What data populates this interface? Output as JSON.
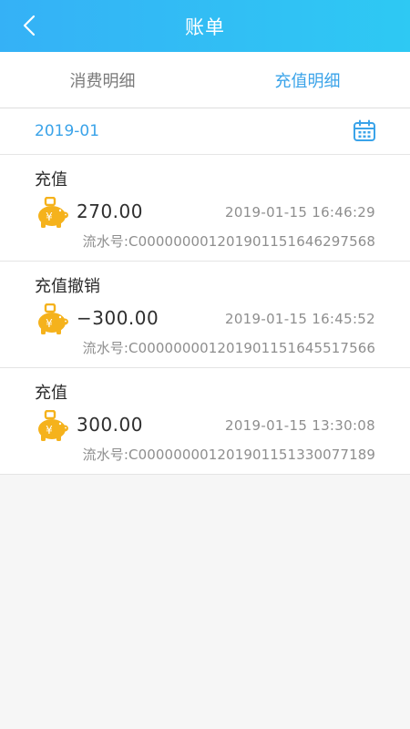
{
  "header": {
    "title": "账单",
    "back_icon": "chevron-left-icon"
  },
  "tabs": [
    {
      "label": "消费明细",
      "active": false
    },
    {
      "label": "充值明细",
      "active": true
    }
  ],
  "filter": {
    "month": "2019-01",
    "calendar_icon": "calendar-icon"
  },
  "records": [
    {
      "type": "充值",
      "amount": "270.00",
      "time": "2019-01-15  16:46:29",
      "serial": "流水号:C000000001201901151646297568"
    },
    {
      "type": "充值撤销",
      "amount": "−300.00",
      "time": "2019-01-15  16:45:52",
      "serial": "流水号:C000000001201901151645517566"
    },
    {
      "type": "充值",
      "amount": "300.00",
      "time": "2019-01-15  13:30:08",
      "serial": "流水号:C000000001201901151330077189"
    }
  ],
  "colors": {
    "header_start": "#35b1f6",
    "header_end": "#2ec9f3",
    "accent": "#3aa3e9",
    "piggy": "#f5b21c"
  }
}
